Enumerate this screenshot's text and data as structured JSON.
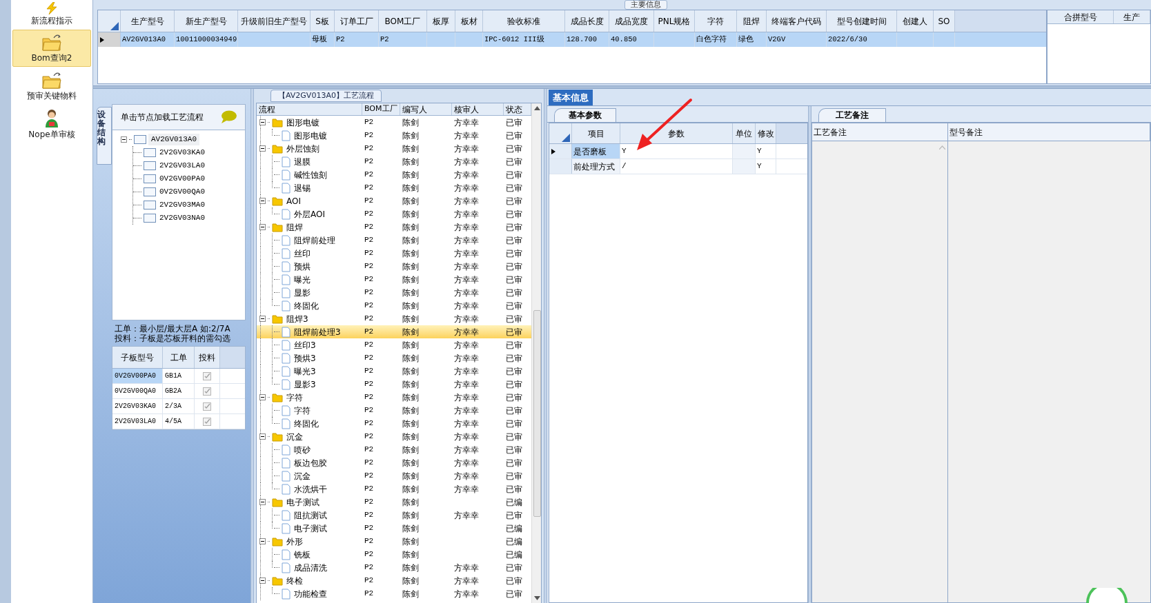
{
  "sidebar": {
    "items": [
      {
        "label": "新流程指示",
        "selected": false
      },
      {
        "label": "Bom查询2",
        "selected": true
      },
      {
        "label": "预审关键物料",
        "selected": false
      },
      {
        "label": "Nope单审核",
        "selected": false
      }
    ]
  },
  "main_info": {
    "title": "主要信息",
    "columns": [
      "生产型号",
      "新生产型号",
      "升级前旧生产型号",
      "S板",
      "订单工厂",
      "BOM工厂",
      "板厚",
      "板材",
      "验收标准",
      "成品长度",
      "成品宽度",
      "PNL规格",
      "字符",
      "阻焊",
      "终端客户代码",
      "型号创建时间",
      "创建人",
      "SO"
    ],
    "rows": [
      {
        "selected": true,
        "cells": [
          "AV2GV013A0",
          "10011000034949",
          null,
          "母板",
          "P2",
          "P2",
          null,
          null,
          "IPC-6012 III级",
          "128.700",
          "40.850",
          null,
          "白色字符",
          "绿色",
          "V2GV",
          "2022/6/30",
          null,
          null
        ]
      }
    ]
  },
  "merge_panel": {
    "columns": [
      "合拼型号",
      "生产"
    ]
  },
  "structure_panel": {
    "side_tab": "设备结构",
    "hint": "单击节点加载工艺流程",
    "tree": {
      "label": "AV2GV013A0",
      "expanded": true,
      "children": [
        {
          "label": "2V2GV03KA0"
        },
        {
          "label": "2V2GV03LA0"
        },
        {
          "label": "0V2GV00PA0"
        },
        {
          "label": "0V2GV00QA0"
        },
        {
          "label": "2V2GV03MA0"
        },
        {
          "label": "2V2GV03NA0"
        }
      ]
    },
    "note": [
      "工单：最小层/最大层A 如:2/7A",
      "投料：子板是芯板开料的需勾选"
    ],
    "grid": {
      "columns": [
        "子板型号",
        "工单",
        "投料"
      ],
      "rows": [
        {
          "cells": [
            "0V2GV00PA0",
            "GB1A"
          ],
          "checked": true,
          "selected": true
        },
        {
          "cells": [
            "0V2GV00QA0",
            "GB2A"
          ],
          "checked": true,
          "selected": false
        },
        {
          "cells": [
            "2V2GV03KA0",
            "2/3A"
          ],
          "checked": true,
          "selected": false
        },
        {
          "cells": [
            "2V2GV03LA0",
            "4/5A"
          ],
          "checked": true,
          "selected": false
        }
      ]
    }
  },
  "process_flow": {
    "title": "【AV2GV013A0】工艺流程",
    "columns": [
      "流程",
      "BOM工厂",
      "编写人",
      "核审人",
      "状态"
    ],
    "rows": [
      {
        "label": "图形电镀",
        "factory": "P2",
        "writer": "陈剑",
        "reviewer": "方幸幸",
        "status": "已审",
        "expanded": true,
        "selected": false,
        "children": [
          {
            "label": "图形电镀",
            "factory": "P2",
            "writer": "陈剑",
            "reviewer": "方幸幸",
            "status": "已审",
            "selected": false
          }
        ]
      },
      {
        "label": "外层蚀刻",
        "factory": "P2",
        "writer": "陈剑",
        "reviewer": "方幸幸",
        "status": "已审",
        "expanded": true,
        "selected": false,
        "children": [
          {
            "label": "退膜",
            "factory": "P2",
            "writer": "陈剑",
            "reviewer": "方幸幸",
            "status": "已审",
            "selected": false
          },
          {
            "label": "碱性蚀刻",
            "factory": "P2",
            "writer": "陈剑",
            "reviewer": "方幸幸",
            "status": "已审",
            "selected": false
          },
          {
            "label": "退锡",
            "factory": "P2",
            "writer": "陈剑",
            "reviewer": "方幸幸",
            "status": "已审",
            "selected": false
          }
        ]
      },
      {
        "label": "AOI",
        "factory": "P2",
        "writer": "陈剑",
        "reviewer": "方幸幸",
        "status": "已审",
        "expanded": true,
        "selected": false,
        "children": [
          {
            "label": "外层AOI",
            "factory": "P2",
            "writer": "陈剑",
            "reviewer": "方幸幸",
            "status": "已审",
            "selected": false
          }
        ]
      },
      {
        "label": "阻焊",
        "factory": "P2",
        "writer": "陈剑",
        "reviewer": "方幸幸",
        "status": "已审",
        "expanded": true,
        "selected": false,
        "children": [
          {
            "label": "阻焊前处理",
            "factory": "P2",
            "writer": "陈剑",
            "reviewer": "方幸幸",
            "status": "已审",
            "selected": false
          },
          {
            "label": "丝印",
            "factory": "P2",
            "writer": "陈剑",
            "reviewer": "方幸幸",
            "status": "已审",
            "selected": false
          },
          {
            "label": "预烘",
            "factory": "P2",
            "writer": "陈剑",
            "reviewer": "方幸幸",
            "status": "已审",
            "selected": false
          },
          {
            "label": "曝光",
            "factory": "P2",
            "writer": "陈剑",
            "reviewer": "方幸幸",
            "status": "已审",
            "selected": false
          },
          {
            "label": "显影",
            "factory": "P2",
            "writer": "陈剑",
            "reviewer": "方幸幸",
            "status": "已审",
            "selected": false
          },
          {
            "label": "终固化",
            "factory": "P2",
            "writer": "陈剑",
            "reviewer": "方幸幸",
            "status": "已审",
            "selected": false
          }
        ]
      },
      {
        "label": "阻焊3",
        "factory": "P2",
        "writer": "陈剑",
        "reviewer": "方幸幸",
        "status": "已审",
        "expanded": true,
        "selected": false,
        "children": [
          {
            "label": "阻焊前处理3",
            "factory": "P2",
            "writer": "陈剑",
            "reviewer": "方幸幸",
            "status": "已审",
            "selected": true
          },
          {
            "label": "丝印3",
            "factory": "P2",
            "writer": "陈剑",
            "reviewer": "方幸幸",
            "status": "已审",
            "selected": false
          },
          {
            "label": "预烘3",
            "factory": "P2",
            "writer": "陈剑",
            "reviewer": "方幸幸",
            "status": "已审",
            "selected": false
          },
          {
            "label": "曝光3",
            "factory": "P2",
            "writer": "陈剑",
            "reviewer": "方幸幸",
            "status": "已审",
            "selected": false
          },
          {
            "label": "显影3",
            "factory": "P2",
            "writer": "陈剑",
            "reviewer": "方幸幸",
            "status": "已审",
            "selected": false
          }
        ]
      },
      {
        "label": "字符",
        "factory": "P2",
        "writer": "陈剑",
        "reviewer": "方幸幸",
        "status": "已审",
        "expanded": true,
        "selected": false,
        "children": [
          {
            "label": "字符",
            "factory": "P2",
            "writer": "陈剑",
            "reviewer": "方幸幸",
            "status": "已审",
            "selected": false
          },
          {
            "label": "终固化",
            "factory": "P2",
            "writer": "陈剑",
            "reviewer": "方幸幸",
            "status": "已审",
            "selected": false
          }
        ]
      },
      {
        "label": "沉金",
        "factory": "P2",
        "writer": "陈剑",
        "reviewer": "方幸幸",
        "status": "已审",
        "expanded": true,
        "selected": false,
        "children": [
          {
            "label": "喷砂",
            "factory": "P2",
            "writer": "陈剑",
            "reviewer": "方幸幸",
            "status": "已审",
            "selected": false
          },
          {
            "label": "板边包胶",
            "factory": "P2",
            "writer": "陈剑",
            "reviewer": "方幸幸",
            "status": "已审",
            "selected": false
          },
          {
            "label": "沉金",
            "factory": "P2",
            "writer": "陈剑",
            "reviewer": "方幸幸",
            "status": "已审",
            "selected": false
          },
          {
            "label": "水洗烘干",
            "factory": "P2",
            "writer": "陈剑",
            "reviewer": "方幸幸",
            "status": "已审",
            "selected": false
          }
        ]
      },
      {
        "label": "电子测试",
        "factory": "P2",
        "writer": "陈剑",
        "status": "已编",
        "expanded": true,
        "selected": false,
        "children": [
          {
            "label": "阻抗测试",
            "factory": "P2",
            "writer": "陈剑",
            "reviewer": "方幸幸",
            "status": "已审",
            "selected": false
          },
          {
            "label": "电子测试",
            "factory": "P2",
            "writer": "陈剑",
            "status": "已编",
            "selected": false
          }
        ]
      },
      {
        "label": "外形",
        "factory": "P2",
        "writer": "陈剑",
        "status": "已编",
        "expanded": true,
        "selected": false,
        "children": [
          {
            "label": "铣板",
            "factory": "P2",
            "writer": "陈剑",
            "status": "已编",
            "selected": false
          },
          {
            "label": "成品清洗",
            "factory": "P2",
            "writer": "陈剑",
            "reviewer": "方幸幸",
            "status": "已审",
            "selected": false
          }
        ]
      },
      {
        "label": "终检",
        "factory": "P2",
        "writer": "陈剑",
        "reviewer": "方幸幸",
        "status": "已审",
        "expanded": true,
        "selected": false,
        "children": [
          {
            "label": "功能检查",
            "factory": "P2",
            "writer": "陈剑",
            "reviewer": "方幸幸",
            "status": "已审",
            "selected": false
          }
        ]
      }
    ]
  },
  "info_tabs": [
    {
      "label": "基本信息",
      "selected": true
    }
  ],
  "basic_params": {
    "tab": "基本参数",
    "columns": [
      "项目",
      "参数",
      "单位",
      "修改"
    ],
    "rows": [
      {
        "selected": true,
        "cells": [
          "是否磨板",
          "Y",
          null,
          "Y"
        ]
      },
      {
        "selected": false,
        "cells": [
          "前处理方式",
          "/",
          null,
          "Y"
        ]
      }
    ]
  },
  "process_notes": {
    "tab": "工艺备注",
    "columns": [
      "工艺备注",
      "型号备注"
    ]
  }
}
